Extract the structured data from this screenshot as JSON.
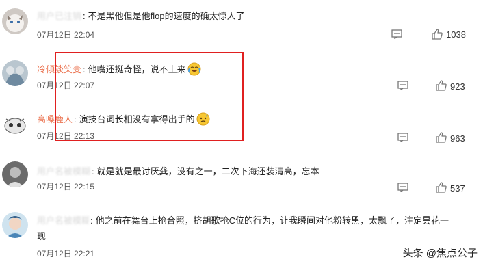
{
  "comments": [
    {
      "username": "用户已注销",
      "username_blurred": true,
      "text": "不是黑他但是他flop的速度的确太惊人了",
      "time": "07月12日 22:04",
      "likes": "1038",
      "emoji": ""
    },
    {
      "username": "冷傾談笑变",
      "username_blurred": false,
      "text": "他嘴还挺奇怪，说不上来",
      "time": "07月12日 22:07",
      "likes": "923",
      "emoji": "laughing-crying-emoji"
    },
    {
      "username": "高嗓鹿人",
      "username_blurred": false,
      "text": "演技台词长相没有拿得出手的",
      "time": "07月12日 22:13",
      "likes": "963",
      "emoji": "sweat-emoji"
    },
    {
      "username": "用户名被模糊",
      "username_blurred": true,
      "text": "就是就是最讨厌龚，没有之一，二次下海还装清高，忘本",
      "time": "07月12日 22:15",
      "likes": "537",
      "emoji": ""
    },
    {
      "username": "用户名被模糊",
      "username_blurred": true,
      "text": "他之前在舞台上抢合照，挤胡歌抢C位的行为，让我瞬间对他粉转黑，太飘了，注定昙花一",
      "text_wrap": "现",
      "time": "07月12日 22:21",
      "likes": "",
      "emoji": ""
    }
  ],
  "watermark": "头条 @焦点公子",
  "colors": {
    "accent_username": "#eb7350",
    "highlight_border": "#e02020"
  }
}
